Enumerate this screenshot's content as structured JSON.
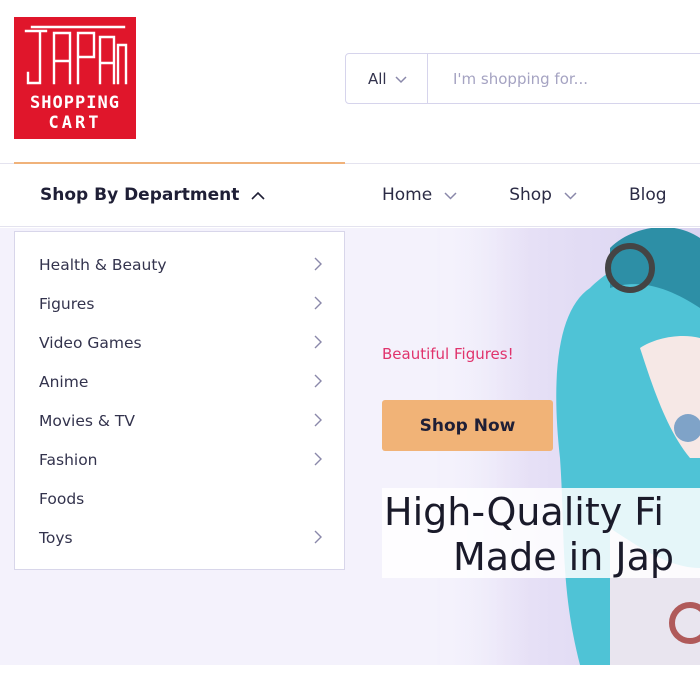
{
  "logo": {
    "line1": "JAPAN",
    "line2": "SHOPPING",
    "line3": "CART",
    "color": "#e0162b"
  },
  "search": {
    "category": "All",
    "placeholder": "I'm shopping for..."
  },
  "nav": {
    "department_label": "Shop By Department",
    "items": [
      {
        "label": "Home"
      },
      {
        "label": "Shop"
      },
      {
        "label": "Blog"
      }
    ]
  },
  "departments": [
    {
      "label": "Health & Beauty",
      "has_submenu": true
    },
    {
      "label": "Figures",
      "has_submenu": true
    },
    {
      "label": "Video Games",
      "has_submenu": true
    },
    {
      "label": "Anime",
      "has_submenu": true
    },
    {
      "label": "Movies & TV",
      "has_submenu": true
    },
    {
      "label": "Fashion",
      "has_submenu": true
    },
    {
      "label": "Foods",
      "has_submenu": false
    },
    {
      "label": "Toys",
      "has_submenu": true
    }
  ],
  "hero": {
    "tagline": "Beautiful Figures!",
    "button_label": "Shop Now",
    "headline_line1": "High-Quality Fi",
    "headline_line2": "Made in Jap"
  },
  "colors": {
    "accent": "#f1b377",
    "tagline": "#e0336c",
    "text": "#1f1f36"
  },
  "icons": {
    "category_chevron": "chevron-down-icon",
    "department_chevron": "chevron-up-icon",
    "submenu_arrow": "chevron-right-icon"
  }
}
